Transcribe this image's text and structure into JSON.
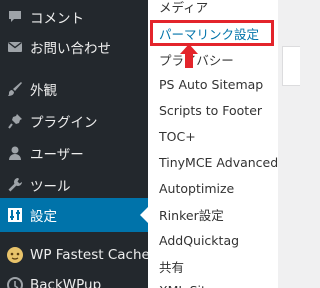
{
  "sidebar": {
    "items": [
      {
        "label": "コメント",
        "icon": "comment-icon"
      },
      {
        "label": "お問い合わせ",
        "icon": "mail-icon"
      },
      {
        "label": "外観",
        "icon": "brush-icon"
      },
      {
        "label": "プラグイン",
        "icon": "plugin-icon"
      },
      {
        "label": "ユーザー",
        "icon": "user-icon"
      },
      {
        "label": "ツール",
        "icon": "wrench-icon"
      },
      {
        "label": "設定",
        "icon": "settings-icon",
        "current": true
      },
      {
        "label": "WP Fastest Cache",
        "icon": "cheetah-icon"
      },
      {
        "label": "BackWPup",
        "icon": "backwpup-icon"
      }
    ]
  },
  "submenu": {
    "items": [
      {
        "label": "メディア"
      },
      {
        "label": "パーマリンク設定",
        "active": true
      },
      {
        "label": "プライバシー"
      },
      {
        "label": "PS Auto Sitemap"
      },
      {
        "label": "Scripts to Footer"
      },
      {
        "label": "TOC+"
      },
      {
        "label": "TinyMCE Advanced"
      },
      {
        "label": "Autoptimize"
      },
      {
        "label": "Rinker設定"
      },
      {
        "label": "AddQuicktag"
      },
      {
        "label": "共有"
      },
      {
        "label": "XML-Sitemap"
      }
    ]
  },
  "colors": {
    "sidebar_bg": "#23282d",
    "current_bg": "#0073aa",
    "highlight": "#e3242b",
    "submenu_bg": "#ffffff"
  }
}
